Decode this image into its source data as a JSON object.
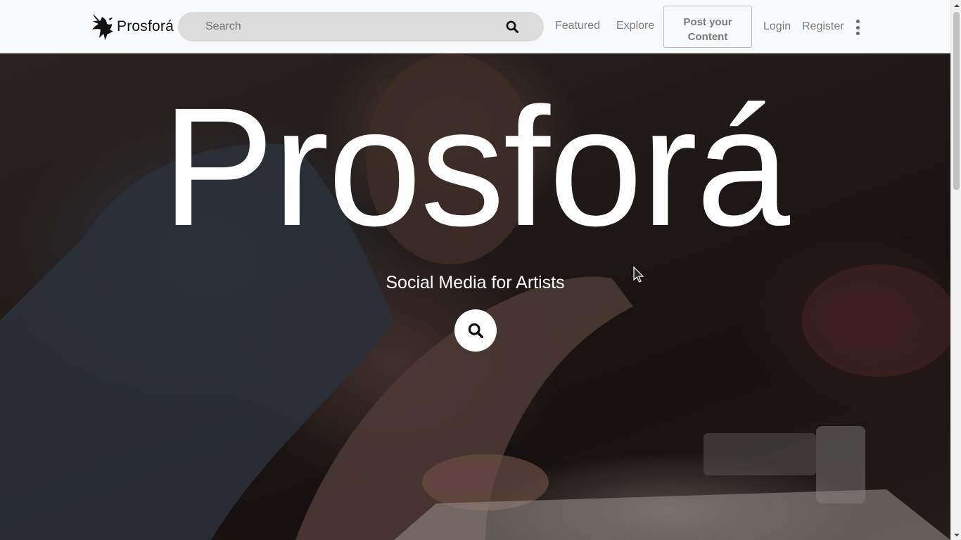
{
  "header": {
    "brand_name": "Prosforá",
    "search": {
      "placeholder": "Search",
      "value": ""
    },
    "nav": {
      "featured": "Featured",
      "explore": "Explore",
      "post_line1": "Post your",
      "post_line2": "Content",
      "login": "Login",
      "register": "Register"
    }
  },
  "hero": {
    "title": "Prosforá",
    "subtitle": "Social Media for Artists"
  },
  "icons": {
    "brand_logo": "bird-logo-icon",
    "search": "search-icon",
    "more": "kebab-menu-icon",
    "hero_search": "search-icon"
  },
  "colors": {
    "navbar_bg": "#f8f9fa",
    "search_bg": "#dcdcdc",
    "nav_text": "#7d7d7d",
    "hero_text": "#ffffff"
  }
}
